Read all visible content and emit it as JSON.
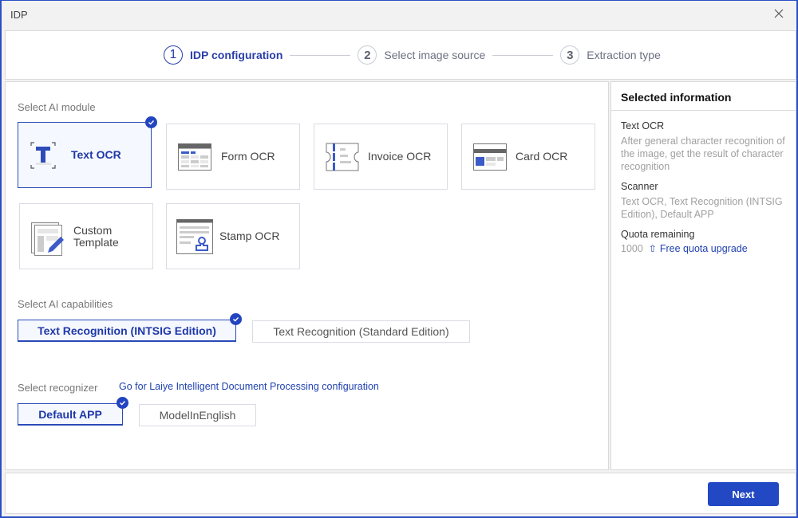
{
  "window": {
    "title": "IDP"
  },
  "stepper": {
    "steps": [
      {
        "number": "1",
        "label": "IDP configuration",
        "state": "active"
      },
      {
        "number": "2",
        "label": "Select image source",
        "state": "inactive"
      },
      {
        "number": "3",
        "label": "Extraction type",
        "state": "inactive"
      }
    ]
  },
  "modules": {
    "label": "Select AI module",
    "items": [
      {
        "label": "Text OCR",
        "icon": "text-ocr-icon",
        "selected": true
      },
      {
        "label": "Form OCR",
        "icon": "form-ocr-icon",
        "selected": false
      },
      {
        "label": "Invoice OCR",
        "icon": "invoice-ocr-icon",
        "selected": false
      },
      {
        "label": "Card OCR",
        "icon": "card-ocr-icon",
        "selected": false
      },
      {
        "label": "Custom Template",
        "icon": "custom-template-icon",
        "selected": false
      },
      {
        "label": "Stamp OCR",
        "icon": "stamp-ocr-icon",
        "selected": false
      }
    ]
  },
  "capabilities": {
    "label": "Select AI capabilities",
    "options": [
      {
        "label": "Text Recognition (INTSIG Edition)",
        "selected": true
      },
      {
        "label": "Text Recognition (Standard Edition)",
        "selected": false
      }
    ]
  },
  "recognizer": {
    "label": "Select recognizer",
    "link": "Go for Laiye Intelligent Document Processing configuration",
    "options": [
      {
        "label": "Default APP",
        "selected": true
      },
      {
        "label": "ModelInEnglish",
        "selected": false
      }
    ]
  },
  "side": {
    "title": "Selected information",
    "module_title": "Text OCR",
    "module_desc": "After general character recognition of the image, get the result of character recognition",
    "scanner_title": "Scanner",
    "scanner_desc": "Text OCR, Text Recognition (INTSIG Edition), Default APP",
    "quota_title": "Quota remaining",
    "quota_value": "1000",
    "quota_link": "Free quota upgrade"
  },
  "footer": {
    "next_label": "Next"
  },
  "colors": {
    "accent": "#2248c4",
    "selected_bg": "#f5f8ff",
    "border": "#d9dce3"
  }
}
